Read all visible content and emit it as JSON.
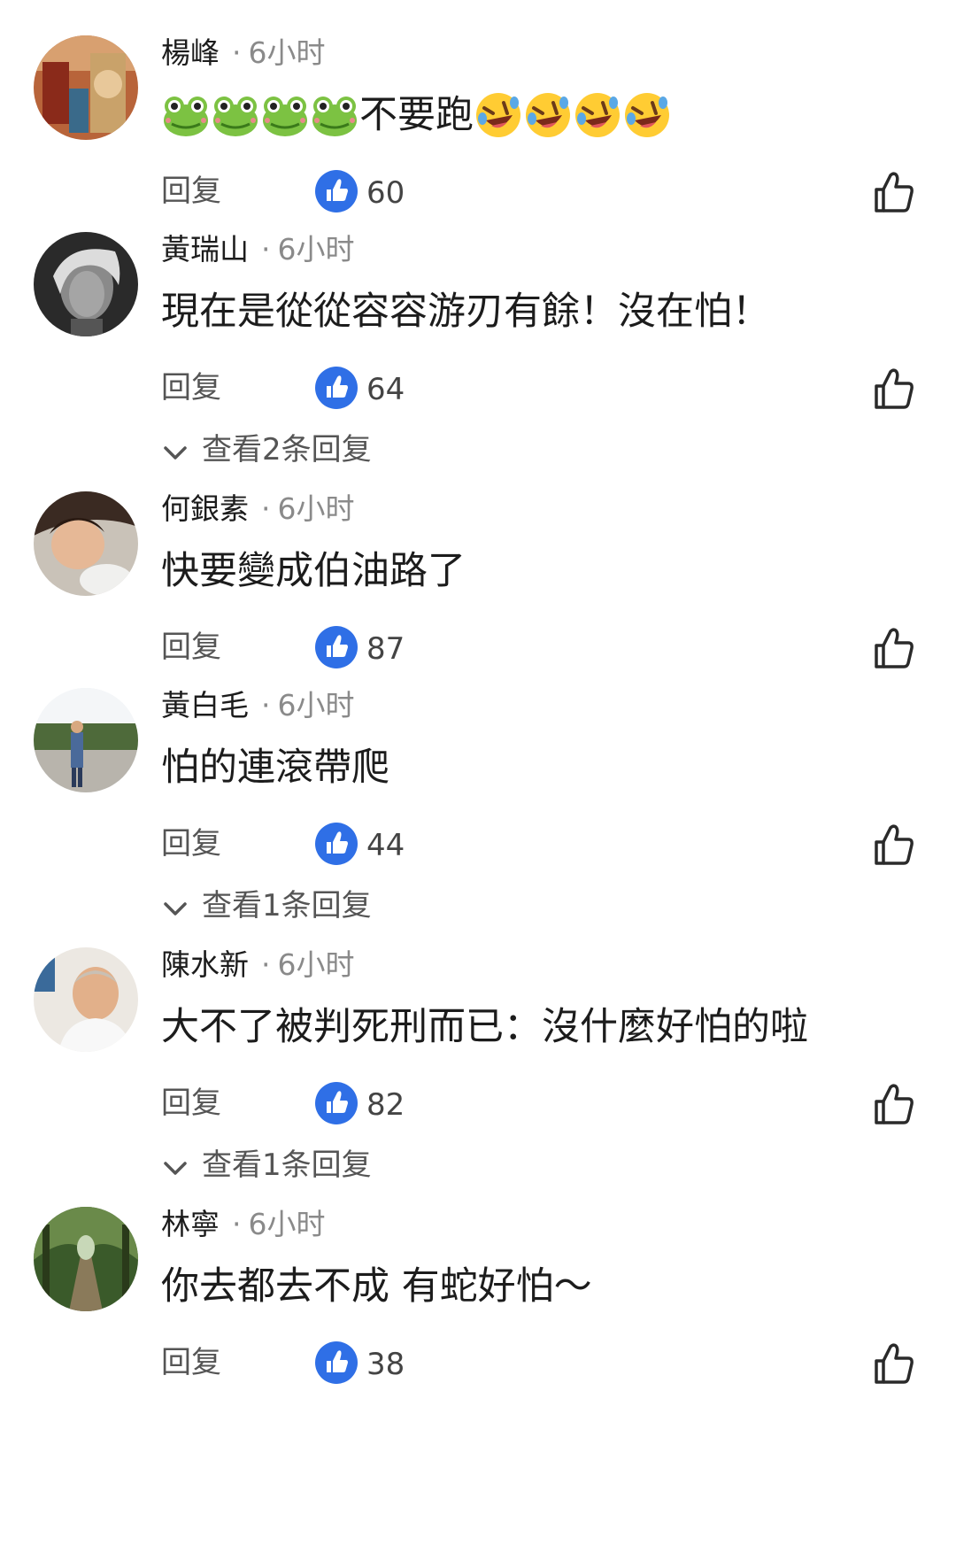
{
  "reply_label": "回复",
  "comments": [
    {
      "name": "楊峰",
      "time": "6小时",
      "frogs": [
        "frog-emoji",
        "frog-emoji",
        "frog-emoji",
        "frog-emoji"
      ],
      "text": "不要跑",
      "laughs": [
        "rolling-laughing-emoji",
        "rolling-laughing-emoji",
        "rolling-laughing-emoji",
        "rolling-laughing-emoji"
      ],
      "likes": "60"
    },
    {
      "name": "黃瑞山",
      "time": "6小时",
      "text": "現在是從從容容游刃有餘！沒在怕！",
      "likes": "64",
      "more": "查看2条回复"
    },
    {
      "name": "何銀素",
      "time": "6小时",
      "text": "快要變成伯油路了",
      "likes": "87"
    },
    {
      "name": "黃白毛",
      "time": "6小时",
      "text": "怕的連滾帶爬",
      "likes": "44",
      "more": "查看1条回复"
    },
    {
      "name": "陳水新",
      "time": "6小时",
      "text": "大不了被判死刑而已：沒什麼好怕的啦",
      "likes": "82",
      "more": "查看1条回复"
    },
    {
      "name": "林寧",
      "time": "6小时",
      "text": "你去都去不成 有蛇好怕～",
      "likes": "38"
    }
  ],
  "colors": {
    "like_badge": "#2f6fe6",
    "meta_gray": "#8a8a8a",
    "text": "#1c1c1c"
  }
}
